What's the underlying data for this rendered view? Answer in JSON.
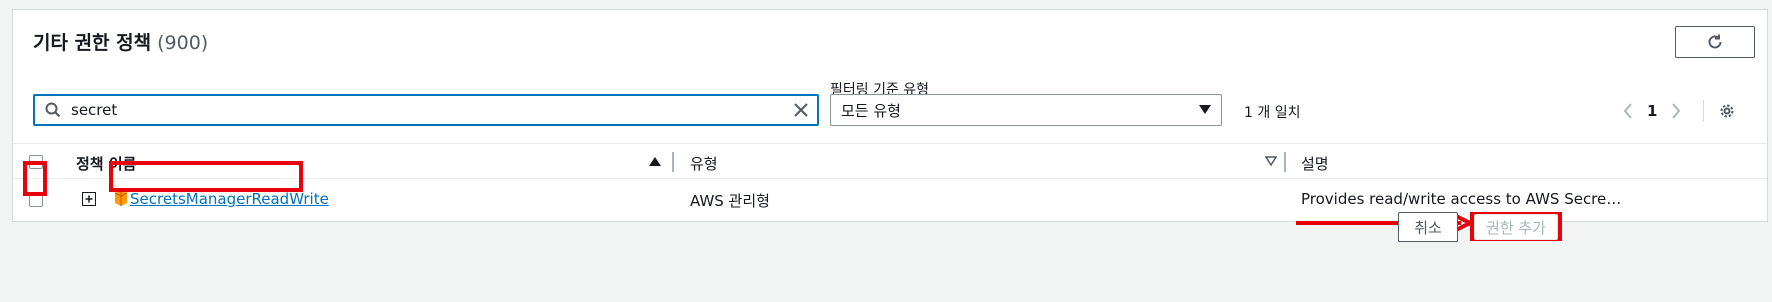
{
  "panel": {
    "title": "기타 권한 정책",
    "count": "(900)"
  },
  "search": {
    "value": "secret",
    "placeholder": ""
  },
  "filter": {
    "label": "필터링 기준 유형",
    "selected": "모든 유형"
  },
  "match_text": "1 개 일치",
  "pagination": {
    "current_page": "1"
  },
  "table": {
    "columns": [
      "정책 이름",
      "유형",
      "설명"
    ],
    "rows": [
      {
        "name": "SecretsManagerReadWrite",
        "type": "AWS 관리형",
        "description": "Provides read/write access to AWS Secre…"
      }
    ]
  },
  "footer": {
    "cancel_label": "취소",
    "add_label": "권한 추가"
  },
  "colors": {
    "accent": "#0073bb",
    "highlight_red": "#e8000b",
    "policy_icon": "#f90"
  }
}
